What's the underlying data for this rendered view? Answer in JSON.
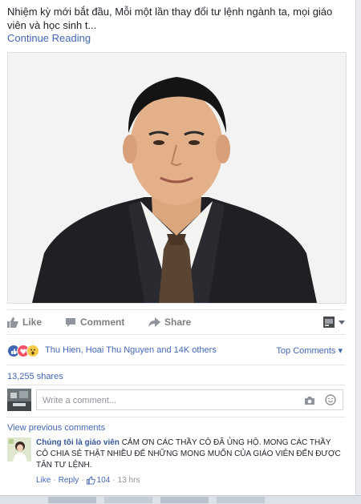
{
  "post": {
    "text": "Nhiệm kỳ mới bắt đầu, Mỗi một lần thay đổi tư lệnh ngành ta, mọi giáo viên và học sinh t...",
    "continue_label": "Continue Reading"
  },
  "actions": {
    "like": "Like",
    "comment": "Comment",
    "share": "Share"
  },
  "reactions": {
    "names": "Thu Hien, Hoai Thu Nguyen and 14K others",
    "sort_label": "Top Comments"
  },
  "shares": "13,255 shares",
  "composer": {
    "placeholder": "Write a comment..."
  },
  "comments": {
    "view_previous": "View previous comments",
    "items": [
      {
        "author": "Chúng tôi là giáo viên",
        "text": "CẢM ƠN CÁC THẦY CÔ ĐÃ ỦNG HỘ. MONG CÁC THẦY CÔ CHIA SẺ THẬT NHIỀU ĐỂ NHỮNG MONG MUỐN CỦA GIÁO VIÊN ĐẾN ĐƯỢC TÂN TƯ LỆNH.",
        "like": "Like",
        "reply": "Reply",
        "like_count": "104",
        "time": "13 hrs"
      }
    ]
  },
  "colors": {
    "link": "#4267b2",
    "author": "#365899",
    "muted": "#90949c"
  }
}
